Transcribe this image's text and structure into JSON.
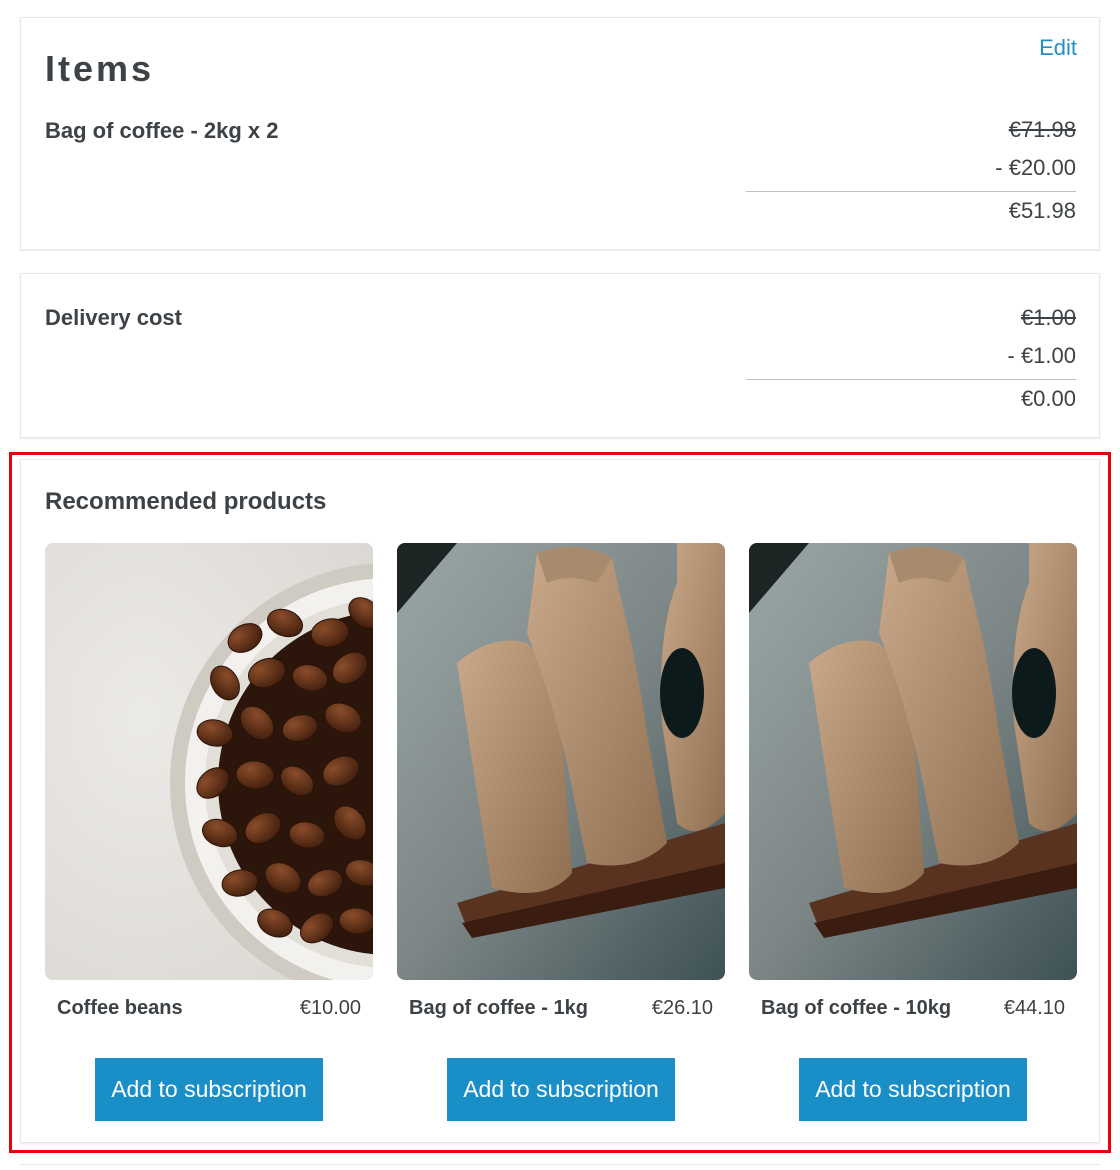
{
  "items_section": {
    "title": "Items",
    "edit_label": "Edit",
    "line": {
      "name": "Bag of coffee - 2kg x 2",
      "original_price": "€71.98",
      "discount": "- €20.00",
      "final_price": "€51.98"
    }
  },
  "delivery_section": {
    "name": "Delivery cost",
    "original_price": "€1.00",
    "discount": "- €1.00",
    "final_price": "€0.00"
  },
  "recommended": {
    "title": "Recommended products",
    "products": [
      {
        "name": "Coffee beans",
        "price": "€10.00",
        "button_label": "Add to subscription",
        "image_icon": "coffee-beans-bowl-image"
      },
      {
        "name": "Bag of coffee - 1kg",
        "price": "€26.10",
        "button_label": "Add to subscription",
        "image_icon": "burlap-coffee-bags-image"
      },
      {
        "name": "Bag of coffee - 10kg",
        "price": "€44.10",
        "button_label": "Add to subscription",
        "image_icon": "burlap-coffee-bags-image"
      }
    ]
  },
  "colors": {
    "accent": "#1a8fc7",
    "link": "#1f8fc4",
    "highlight": "#e8000b",
    "text": "#3d4246"
  }
}
